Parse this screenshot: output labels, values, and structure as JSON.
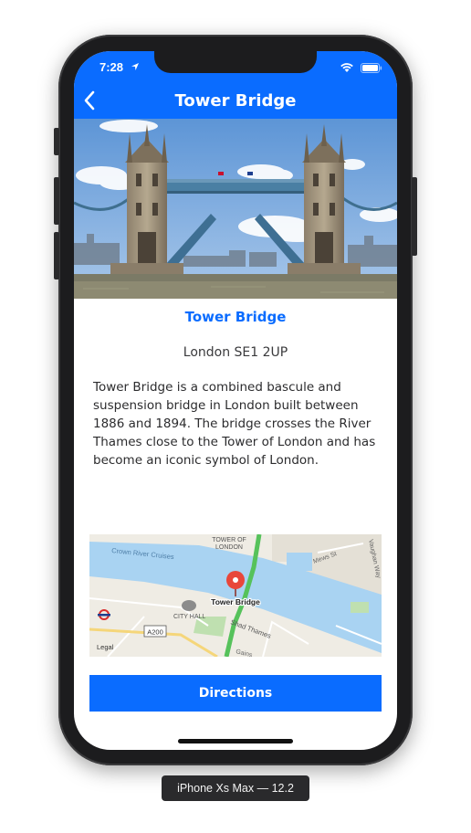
{
  "status_bar": {
    "time": "7:28"
  },
  "nav": {
    "title": "Tower Bridge"
  },
  "landmark": {
    "name": "Tower Bridge",
    "address": "London SE1 2UP",
    "description": "Tower Bridge is a combined bascule and suspension bridge in London built between 1886 and 1894. The bridge crosses the River Thames close to the Tower of London and has become an iconic symbol of London."
  },
  "map": {
    "pin_label": "Tower Bridge",
    "labels": {
      "tower_of_london_1": "TOWER OF",
      "tower_of_london_2": "LONDON",
      "crown_river_cruises": "Crown River Cruises",
      "mews_st": "Mews St",
      "vaughan_way": "Vaughan Way",
      "city_hall": "CITY HALL",
      "shad_thames": "Shad Thames",
      "road_a200": "A200",
      "legal": "Legal",
      "gainsford": "Gains"
    }
  },
  "actions": {
    "directions_label": "Directions"
  },
  "device": {
    "label": "iPhone Xs Max — 12.2"
  },
  "colors": {
    "accent": "#0a6cff",
    "water": "#a9d3f2",
    "pin": "#e8473b"
  }
}
